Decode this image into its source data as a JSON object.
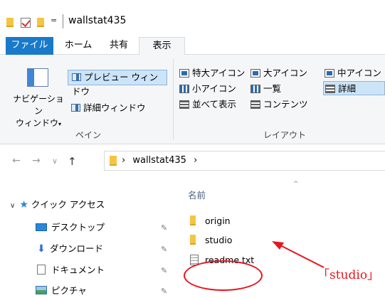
{
  "titlebar": {
    "title": "wallstat435",
    "qa_dropdown": "="
  },
  "tabs": {
    "file": "ファイル",
    "home": "ホーム",
    "share": "共有",
    "view": "表示"
  },
  "ribbon": {
    "pane_group": {
      "nav_pane_line1": "ナビゲーション",
      "nav_pane_line2": "ウィンドウ",
      "nav_pane_caret": "▾",
      "preview": "プレビュー ウィンドウ",
      "details": "詳細ウィンドウ",
      "label": "ペイン"
    },
    "layout_group": {
      "extra_large": "特大アイコン",
      "large": "大アイコン",
      "medium": "中アイコン",
      "small": "小アイコン",
      "list": "一覧",
      "details": "詳細",
      "tiles": "並べて表示",
      "content": "コンテンツ",
      "label": "レイアウト",
      "active": "details"
    }
  },
  "address": {
    "back": "←",
    "forward": "→",
    "recent": "∨",
    "up": "↑",
    "sep1": "›",
    "path": "wallstat435",
    "sep2": "›"
  },
  "navpane": {
    "quick_access": "クイック アクセス",
    "items": [
      {
        "label": "デスクトップ",
        "pinned": true
      },
      {
        "label": "ダウンロード",
        "pinned": true
      },
      {
        "label": "ドキュメント",
        "pinned": true
      },
      {
        "label": "ピクチャ",
        "pinned": true
      }
    ],
    "pin_glyph": "✎"
  },
  "filelist": {
    "column_name": "名前",
    "sort_indicator": "^",
    "files": [
      {
        "name": "origin",
        "type": "folder"
      },
      {
        "name": "studio",
        "type": "folder"
      },
      {
        "name": "readme.txt",
        "type": "text"
      }
    ]
  },
  "annotation": {
    "label": "「studio」",
    "color": "#e8141e"
  },
  "colors": {
    "accent": "#1979ca",
    "folder": "#f5c542",
    "selected": "#cce4f7"
  }
}
